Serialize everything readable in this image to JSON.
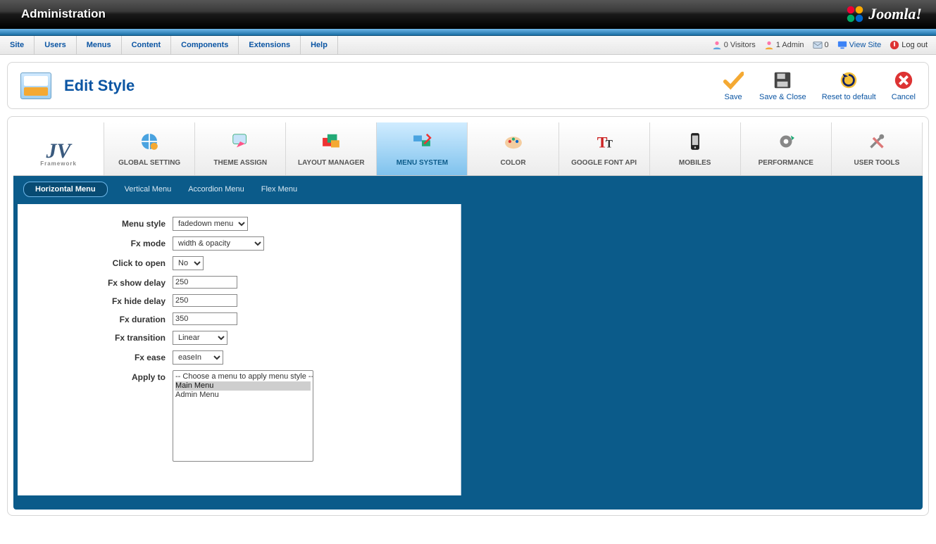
{
  "header": {
    "title": "Administration",
    "brand": "Joomla!"
  },
  "menu": {
    "site": "Site",
    "users": "Users",
    "menus": "Menus",
    "content": "Content",
    "components": "Components",
    "extensions": "Extensions",
    "help": "Help"
  },
  "status": {
    "visitors": "0 Visitors",
    "admin": "1 Admin",
    "msgs": "0",
    "view_site": "View Site",
    "logout": "Log out"
  },
  "page": {
    "title": "Edit Style"
  },
  "toolbar": {
    "save": "Save",
    "save_close": "Save & Close",
    "reset": "Reset to default",
    "cancel": "Cancel"
  },
  "tabs": {
    "global": "GLOBAL SETTING",
    "theme": "THEME ASSIGN",
    "layout": "LAYOUT MANAGER",
    "menu": "MENU SYSTEM",
    "color": "COLOR",
    "font": "GOOGLE FONT API",
    "mobiles": "MOBILES",
    "perf": "PERFORMANCE",
    "tools": "USER TOOLS"
  },
  "subtabs": {
    "horizontal": "Horizontal Menu",
    "vertical": "Vertical Menu",
    "accordion": "Accordion Menu",
    "flex": "Flex Menu"
  },
  "form": {
    "menu_style": {
      "label": "Menu style",
      "value": "fadedown menu"
    },
    "fx_mode": {
      "label": "Fx mode",
      "value": "width & opacity"
    },
    "click_open": {
      "label": "Click to open",
      "value": "No"
    },
    "fx_show": {
      "label": "Fx show delay",
      "value": "250"
    },
    "fx_hide": {
      "label": "Fx hide delay",
      "value": "250"
    },
    "fx_dur": {
      "label": "Fx duration",
      "value": "350"
    },
    "fx_trans": {
      "label": "Fx transition",
      "value": "Linear"
    },
    "fx_ease": {
      "label": "Fx ease",
      "value": "easeIn"
    },
    "apply_to": {
      "label": "Apply to",
      "options": [
        "-- Choose a menu to apply menu style --",
        "Main Menu",
        "Admin Menu"
      ],
      "selected": "Main Menu"
    }
  }
}
